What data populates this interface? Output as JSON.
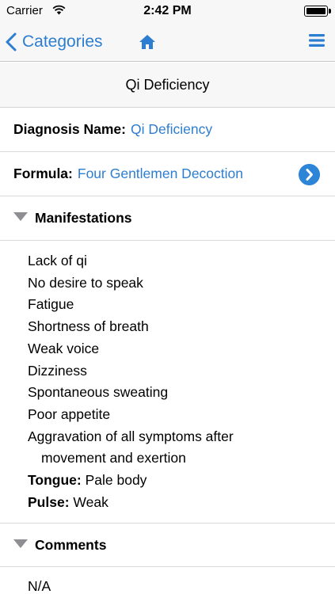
{
  "status": {
    "carrier": "Carrier",
    "time": "2:42 PM"
  },
  "nav": {
    "back_label": "Categories"
  },
  "page": {
    "title": "Qi Deficiency"
  },
  "diagnosis": {
    "label": "Diagnosis Name:",
    "value": "Qi Deficiency"
  },
  "formula": {
    "label": "Formula:",
    "value": "Four Gentlemen Decoction"
  },
  "manifestations": {
    "heading": "Manifestations",
    "items": [
      "Lack of qi",
      "No desire to speak",
      "Fatigue",
      "Shortness of breath",
      "Weak voice",
      "Dizziness",
      "Spontaneous sweating",
      "Poor appetite",
      "Aggravation of all symptoms after",
      "movement and exertion"
    ],
    "tongue_label": "Tongue:",
    "tongue_value": "Pale body",
    "pulse_label": "Pulse:",
    "pulse_value": "Weak"
  },
  "comments": {
    "heading": "Comments",
    "value": "N/A"
  },
  "colors": {
    "accent": "#2d7ed0",
    "disclosure": "#2d85d8",
    "triangle": "#8e8e93"
  },
  "icons": {
    "wifi": "wifi-icon",
    "battery": "battery-icon",
    "back": "chevron-left-icon",
    "home": "home-icon",
    "menu": "hamburger-menu-icon",
    "disclosure": "chevron-right-circle-icon",
    "collapse": "triangle-down-icon"
  }
}
